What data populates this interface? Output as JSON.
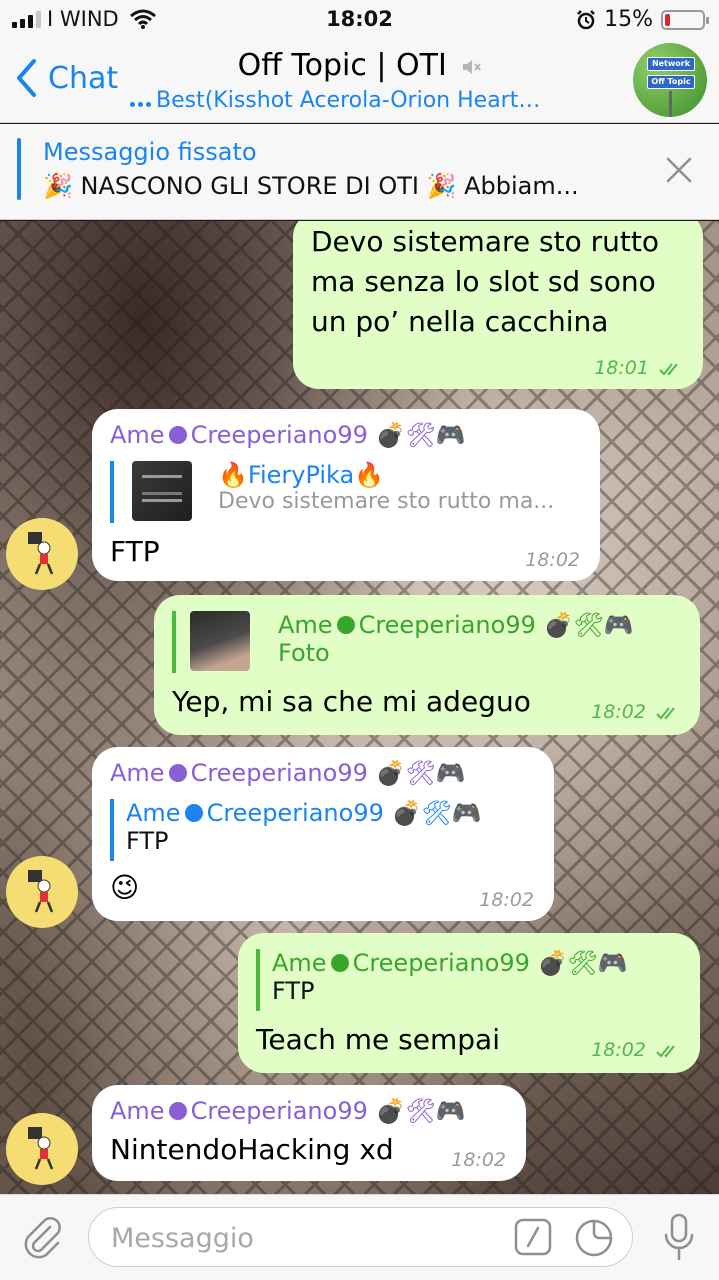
{
  "status_bar": {
    "carrier": "I WIND",
    "time": "18:02",
    "battery_percent": "15%",
    "battery_level": 0.15
  },
  "nav": {
    "back_label": "Chat",
    "title": "Off Topic | OTI",
    "subtitle": "Best(Kisshot Acerola-Orion Heart…",
    "avatar_sign_top": "Network",
    "avatar_sign_bottom": "Off Topic"
  },
  "pinned": {
    "title": "Messaggio fissato",
    "text": "🎉 NASCONO GLI STORE DI OTI 🎉  Abbiam..."
  },
  "messages": [
    {
      "direction": "out",
      "text_line1": "Devo sistemare sto rutto",
      "text_line2": "ma senza lo slot sd sono",
      "text_line3": "un po’ nella cacchina",
      "time": "18:01"
    },
    {
      "direction": "in",
      "sender": "Ame",
      "sender_tail": "Creeperiano99",
      "sender_emoji": "💣🛠🎮",
      "reply_name": "🔥FieryPika🔥",
      "reply_text": "Devo sistemare sto rutto ma...",
      "text": "FTP",
      "time": "18:02"
    },
    {
      "direction": "out",
      "reply_name": "Ame",
      "reply_name_tail": "Creeperiano99",
      "reply_emoji": "💣🛠🎮",
      "reply_text": "Foto",
      "text": "Yep, mi sa che mi adeguo",
      "time": "18:02"
    },
    {
      "direction": "in",
      "sender": "Ame",
      "sender_tail": "Creeperiano99",
      "sender_emoji": "💣🛠🎮",
      "reply_name": "Ame",
      "reply_name_tail": "Creeperiano99",
      "reply_emoji": "💣🛠🎮",
      "reply_text": "FTP",
      "text": "😉",
      "time": "18:02"
    },
    {
      "direction": "out",
      "reply_name": "Ame",
      "reply_name_tail": "Creeperiano99",
      "reply_emoji": "💣🛠🎮",
      "reply_text": "FTP",
      "text": "Teach me sempai",
      "time": "18:02"
    },
    {
      "direction": "in",
      "sender": "Ame",
      "sender_tail": "Creeperiano99",
      "sender_emoji": "💣🛠🎮",
      "text": "NintendoHacking xd",
      "time": "18:02"
    }
  ],
  "input": {
    "placeholder": "Messaggio"
  },
  "colors": {
    "accent": "#1a84f0",
    "outgoing_bubble": "#e1fec6",
    "incoming_bubble": "#ffffff",
    "sender_name": "#8a5fd6",
    "check_green": "#52b84a"
  },
  "icons": [
    "signal-icon",
    "wifi-icon",
    "alarm-icon",
    "battery-icon",
    "back-chevron-icon",
    "mute-icon",
    "close-icon",
    "paperclip-icon",
    "command-icon",
    "sticker-icon",
    "microphone-icon",
    "double-check-icon"
  ]
}
